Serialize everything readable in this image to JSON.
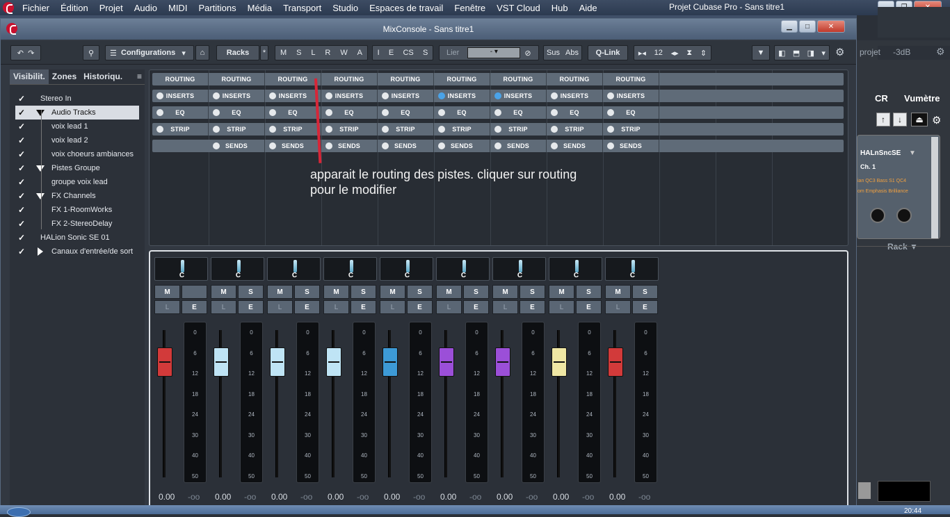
{
  "menubar": {
    "items": [
      "Fichier",
      "Édition",
      "Projet",
      "Audio",
      "MIDI",
      "Partitions",
      "Média",
      "Transport",
      "Studio",
      "Espaces de travail",
      "Fenêtre",
      "VST Cloud",
      "Hub",
      "Aide"
    ],
    "app_title": "Projet Cubase Pro - Sans titre1"
  },
  "window": {
    "title": "MixConsole - Sans titre1"
  },
  "toolbar": {
    "configurations": "Configurations",
    "racks": "Racks",
    "racks_star": "*",
    "mode_buttons": [
      "M",
      "S",
      "L",
      "R",
      "W",
      "A"
    ],
    "insert_buttons": [
      "I",
      "E",
      "CS",
      "S"
    ],
    "lier": "Lier",
    "lier_value": "-",
    "sus": "Sus",
    "abs": "Abs",
    "qlink": "Q-Link",
    "channels_count": "12"
  },
  "left_panel": {
    "tabs": [
      "Visibilit.",
      "Zones",
      "Historiqu."
    ],
    "tree": [
      {
        "label": "Stereo In",
        "indent": 0,
        "expander": "none",
        "selected": false
      },
      {
        "label": "Audio Tracks",
        "indent": 1,
        "expander": "down",
        "selected": true
      },
      {
        "label": "voix lead 1",
        "indent": 2,
        "expander": "none",
        "selected": false
      },
      {
        "label": "voix lead 2",
        "indent": 2,
        "expander": "none",
        "selected": false
      },
      {
        "label": "voix choeurs ambiances",
        "indent": 2,
        "expander": "none",
        "selected": false
      },
      {
        "label": "Pistes Groupe",
        "indent": 1,
        "expander": "down",
        "selected": false
      },
      {
        "label": "groupe voix lead",
        "indent": 2,
        "expander": "none",
        "selected": false
      },
      {
        "label": "FX Channels",
        "indent": 1,
        "expander": "down",
        "selected": false
      },
      {
        "label": "FX 1-RoomWorks",
        "indent": 2,
        "expander": "none",
        "selected": false
      },
      {
        "label": "FX 2-StereoDelay",
        "indent": 2,
        "expander": "none",
        "selected": false
      },
      {
        "label": "HALion Sonic SE 01",
        "indent": 0,
        "expander": "none",
        "selected": false
      },
      {
        "label": "Canaux d'entrée/de sort",
        "indent": 1,
        "expander": "right",
        "selected": false
      }
    ]
  },
  "rack": {
    "routing_label": "ROUTING",
    "inserts_label": "INSERTS",
    "eq_label": "EQ",
    "strip_label": "STRIP",
    "sends_label": "SENDS",
    "routing_count": 9,
    "inserts_count": 9,
    "eq_count": 9,
    "strip_count": 9,
    "sends_count": 8,
    "sends_first_blank": true,
    "inserts_blue": [
      5,
      6
    ]
  },
  "annotation": {
    "text": "apparait le routing des pistes. cliquer sur routing pour le modifier"
  },
  "channels": [
    {
      "pan": "C",
      "m": "M",
      "s": "",
      "l": "L",
      "e": "E",
      "fader_color": "#d23a3a",
      "volume": "0.00",
      "peak": "-oo"
    },
    {
      "pan": "C",
      "m": "M",
      "s": "S",
      "l": "L",
      "e": "E",
      "fader_color": "#bfe4f5",
      "volume": "0.00",
      "peak": "-oo"
    },
    {
      "pan": "C",
      "m": "M",
      "s": "S",
      "l": "L",
      "e": "E",
      "fader_color": "#bfe4f5",
      "volume": "0.00",
      "peak": "-oo"
    },
    {
      "pan": "C",
      "m": "M",
      "s": "S",
      "l": "L",
      "e": "E",
      "fader_color": "#bfe4f5",
      "volume": "0.00",
      "peak": "-oo"
    },
    {
      "pan": "C",
      "m": "M",
      "s": "S",
      "l": "L",
      "e": "E",
      "fader_color": "#3d9ad6",
      "volume": "0.00",
      "peak": "-oo"
    },
    {
      "pan": "C",
      "m": "M",
      "s": "S",
      "l": "L",
      "e": "E",
      "fader_color": "#9b4fd8",
      "volume": "0.00",
      "peak": "-oo"
    },
    {
      "pan": "C",
      "m": "M",
      "s": "S",
      "l": "L",
      "e": "E",
      "fader_color": "#9b4fd8",
      "volume": "0.00",
      "peak": "-oo"
    },
    {
      "pan": "C",
      "m": "M",
      "s": "S",
      "l": "L",
      "e": "E",
      "fader_color": "#efe7a4",
      "volume": "0.00",
      "peak": "-oo"
    },
    {
      "pan": "C",
      "m": "M",
      "s": "S",
      "l": "L",
      "e": "E",
      "fader_color": "#d23a3a",
      "volume": "0.00",
      "peak": "-oo"
    }
  ],
  "meter_scale": [
    "0",
    "6",
    "12",
    "18",
    "24",
    "30",
    "40",
    "50"
  ],
  "right_panel": {
    "projet": "projet",
    "db": "-3dB",
    "cr": "CR",
    "vumetre": "Vumètre",
    "instrument": "HALnSncSE",
    "channel": "Ch. 1",
    "params1": "ian  QC3 Bass  S1 QC4",
    "params2": "om  Emphasis  Brilliance",
    "rack": "Rack"
  },
  "taskbar": {
    "clock": "20:44"
  }
}
